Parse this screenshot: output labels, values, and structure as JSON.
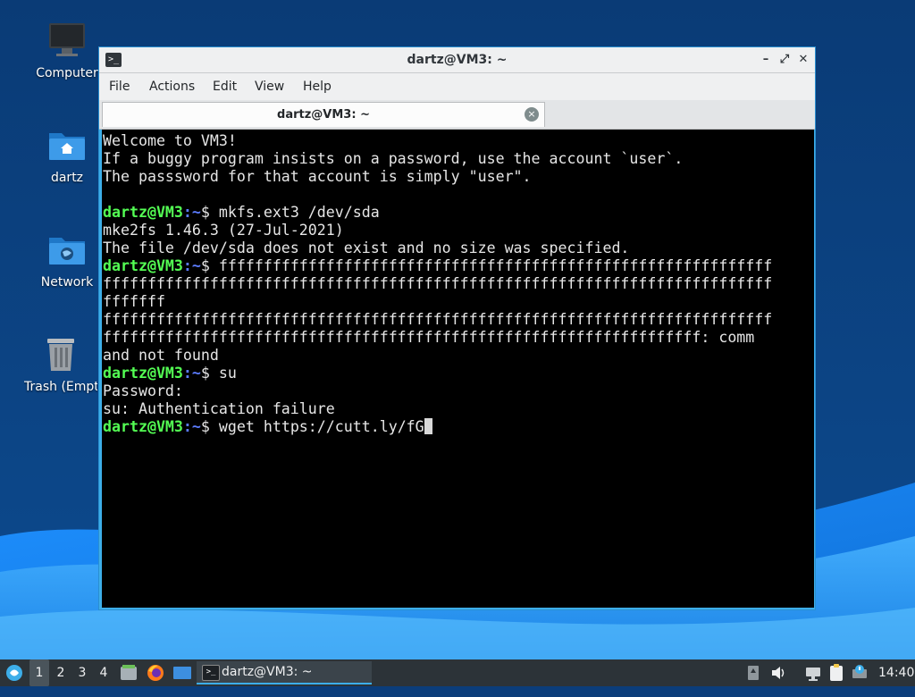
{
  "desktop": {
    "icons": [
      {
        "label": "Computer",
        "icon": "computer-icon"
      },
      {
        "label": "dartz",
        "icon": "home-folder-icon"
      },
      {
        "label": "Network",
        "icon": "network-folder-icon"
      },
      {
        "label": "Trash (Empty)",
        "icon": "trash-icon"
      }
    ]
  },
  "window": {
    "title": "dartz@VM3: ~",
    "controls": {
      "minimize": "–",
      "maximize": "⤢",
      "close": "✕"
    },
    "menu": [
      "File",
      "Actions",
      "Edit",
      "View",
      "Help"
    ],
    "tab": {
      "title": "dartz@VM3: ~",
      "close": "×"
    }
  },
  "terminal": {
    "prompt_user": "dartz@VM3",
    "prompt_path": ":~",
    "prompt_symbol": "$ ",
    "motd": [
      "Welcome to VM3!",
      "If a buggy program insists on a password, use the account `user`.",
      "The passsword for that account is simply \"user\"."
    ],
    "cmd1": "mkfs.ext3 /dev/sda",
    "out1": [
      "mke2fs 1.46.3 (27-Jul-2021)",
      "The file /dev/sda does not exist and no size was specified."
    ],
    "cmd2_line1": "ffffffffffffffffffffffffffffffffffffffffffffffffffffffffffffff",
    "cmd2_rest": [
      "fffffffffffffffffffffffffffffffffffffffffffffffffffffffffffffffffffffffffff",
      "fffffff"
    ],
    "out2": [
      "fffffffffffffffffffffffffffffffffffffffffffffffffffffffffffffffffffffffffff",
      "fffffffffffffffffffffffffffffffffffffffffffffffffffffffffffffffffff: comm",
      "and not found"
    ],
    "cmd3": "su",
    "out3": [
      "Password:",
      "su: Authentication failure"
    ],
    "cmd4": "wget https://cutt.ly/fG"
  },
  "taskbar": {
    "workspaces": [
      "1",
      "2",
      "3",
      "4"
    ],
    "active_workspace": "1",
    "launchers": [
      "menu-icon",
      "file-manager-icon",
      "firefox-icon",
      "show-desktop-icon"
    ],
    "task_label": "dartz@VM3: ~",
    "clock": "14:40"
  },
  "colors": {
    "accent": "#3daee9",
    "prompt_user": "#54ff54",
    "prompt_path": "#5c7cff"
  }
}
